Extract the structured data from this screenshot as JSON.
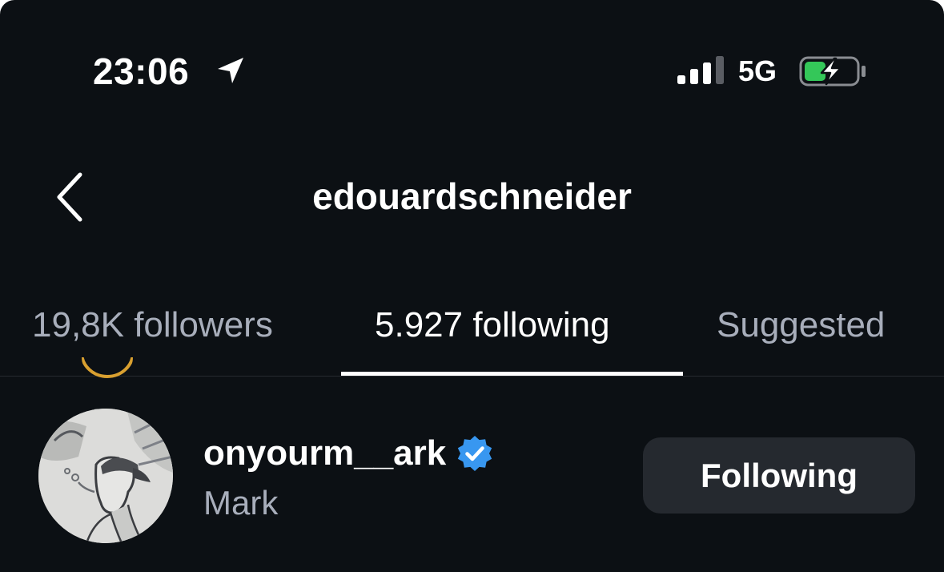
{
  "status_bar": {
    "time": "23:06",
    "network": "5G",
    "icons": [
      "location-arrow-icon",
      "cellular-signal-icon",
      "battery-charging-icon"
    ],
    "battery_color": "#34c759"
  },
  "header": {
    "back_icon": "chevron-left-icon",
    "title": "edouardschneider"
  },
  "tabs": [
    {
      "label": "19,8K followers",
      "active": false
    },
    {
      "label": "5.927 following",
      "active": true
    },
    {
      "label": "Suggested",
      "active": false
    }
  ],
  "list": {
    "items": [
      {
        "username": "onyourm__ark",
        "verified": true,
        "verified_color": "#3897f0",
        "display_name": "Mark",
        "button_label": "Following"
      }
    ]
  },
  "colors": {
    "background": "#0c1014",
    "secondary_text": "#a8aebb",
    "button_background": "#25292f"
  }
}
